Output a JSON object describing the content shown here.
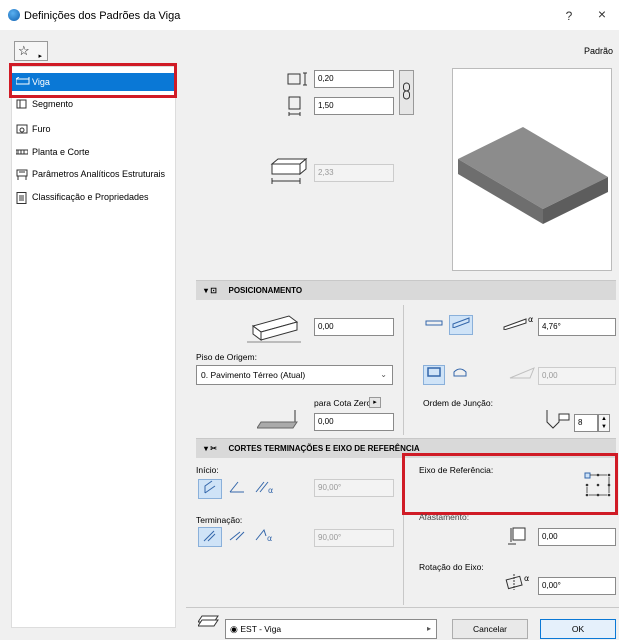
{
  "window": {
    "title": "Definições dos Padrões da Viga",
    "help": "?",
    "close": "×"
  },
  "toolbar": {
    "favorites_icon": "☆",
    "arrow": "▸",
    "profile_label": "Padrão"
  },
  "sidebar": {
    "items": [
      {
        "label": "Viga",
        "icon": "beam-icon",
        "selected": true
      },
      {
        "label": "Segmento",
        "icon": "segment-icon"
      },
      {
        "label": "Furo",
        "icon": "hole-icon"
      },
      {
        "label": "Planta e Corte",
        "icon": "plan-section-icon"
      },
      {
        "label": "Parâmetros Analíticos Estruturais",
        "icon": "structural-icon"
      },
      {
        "label": "Classificação e Propriedades",
        "icon": "classification-icon"
      }
    ]
  },
  "geometry": {
    "height": "0,20",
    "width": "1,50",
    "length": "2,33"
  },
  "positioning": {
    "header": "POSICIONAMENTO",
    "offset": "0,00",
    "home_story_label": "Piso de Origem:",
    "home_story_value": "0. Pavimento Térreo (Atual)",
    "to_zero_label": "para Cota Zero",
    "to_zero_value": "0,00",
    "slope_angle": "4,76°",
    "tilt_value": "0,00",
    "join_order_label": "Ordem de Junção:",
    "join_order_value": "8"
  },
  "ends": {
    "header": "CORTES TERMINAÇÕES E EIXO DE REFERÊNCIA",
    "start_label": "Início:",
    "start_angle": "90,00°",
    "end_label": "Terminação:",
    "end_angle": "90,00°",
    "ref_axis_label": "Eixo de Referência:",
    "offset_label": "Afastamento:",
    "offset_value": "0,00",
    "rotation_label": "Rotação do Eixo:",
    "rotation_value": "0,00°"
  },
  "footer": {
    "layer": "EST - Viga",
    "cancel": "Cancelar",
    "ok": "OK"
  },
  "colors": {
    "selected": "#0a78d6",
    "highlight_box": "#d01b26"
  }
}
